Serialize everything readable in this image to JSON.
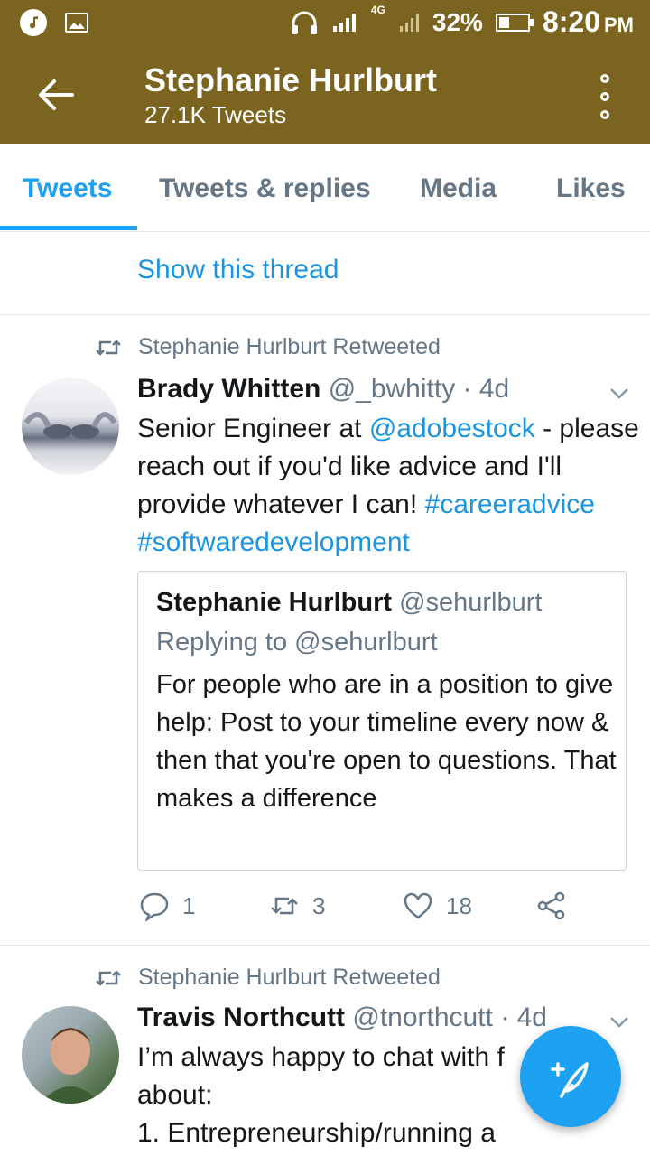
{
  "status_bar": {
    "battery": "32%",
    "time": "8:20",
    "ampm": "PM",
    "network": "4G",
    "icons": [
      "music-icon",
      "gallery-icon",
      "headphones-icon",
      "signal-icon",
      "battery-icon"
    ]
  },
  "header": {
    "title": "Stephanie Hurlburt",
    "subtitle": "27.1K Tweets",
    "icons": [
      "back-arrow-icon",
      "more-options-icon"
    ]
  },
  "tabs": [
    "Tweets",
    "Tweets & replies",
    "Media",
    "Likes"
  ],
  "active_tab": "Tweets",
  "show_thread": "Show this thread",
  "tweets": [
    {
      "retweeted_by": "Stephanie Hurlburt Retweeted",
      "name": "Brady Whitten",
      "handle": "@_bwhitty",
      "time": "· 4d",
      "text_1": "Senior Engineer at ",
      "mention": "@adobestock",
      "text_2": " - please reach out if you'd like advice and I'll provide whatever I can! ",
      "hashtags": "#careeradvice #softwaredevelopment",
      "quote": {
        "name": "Stephanie Hurlburt",
        "handle": "@sehurlburt",
        "replying": "Replying to @sehurlburt",
        "text": "For people who are in a position to give help: Post to your timeline every now & then that you're open to questions. That makes a difference"
      },
      "replies": "1",
      "retweets": "3",
      "likes": "18"
    },
    {
      "retweeted_by": "Stephanie Hurlburt Retweeted",
      "name": "Travis Northcutt",
      "handle": "@tnorthcutt",
      "time": "· 4d",
      "text": "I’m always happy to chat with f about:\n1. Entrepreneurship/running a"
    }
  ],
  "colors": {
    "header_bg": "#7b6420",
    "accent": "#1da1f2",
    "link": "#1b95e0",
    "muted": "#657786"
  }
}
